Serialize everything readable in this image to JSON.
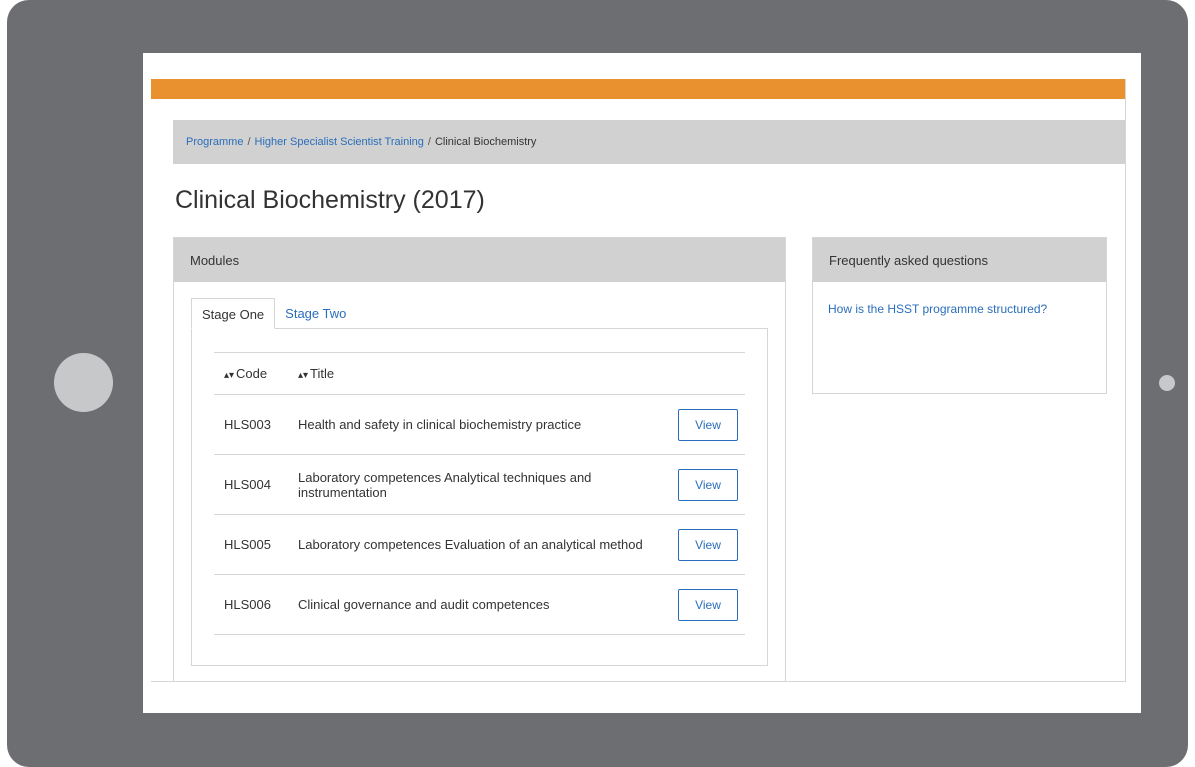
{
  "breadcrumb": {
    "items": [
      "Programme",
      "Higher Specialist Scientist Training"
    ],
    "separator": "/",
    "current": "Clinical Biochemistry"
  },
  "page": {
    "title": "Clinical Biochemistry (2017)"
  },
  "modules": {
    "header": "Modules",
    "tabs": [
      "Stage One",
      "Stage Two"
    ],
    "active_tab": "Stage One",
    "columns": {
      "code": "Code",
      "title": "Title"
    },
    "rows": [
      {
        "code": "HLS003",
        "title": "Health and safety in clinical biochemistry practice",
        "action": "View"
      },
      {
        "code": "HLS004",
        "title": "Laboratory competences Analytical techniques and instrumentation",
        "action": "View"
      },
      {
        "code": "HLS005",
        "title": "Laboratory competences Evaluation of an analytical method",
        "action": "View"
      },
      {
        "code": "HLS006",
        "title": "Clinical governance and audit competences",
        "action": "View"
      }
    ]
  },
  "faq": {
    "header": "Frequently asked questions",
    "links": [
      "How is the HSST programme structured?"
    ]
  },
  "icons": {
    "sort": "sort-icon"
  },
  "colors": {
    "accent_bar": "#e8912e",
    "link": "#2a6ebb",
    "panel_header": "#d1d1d1",
    "device_frame": "#6d6e71"
  }
}
